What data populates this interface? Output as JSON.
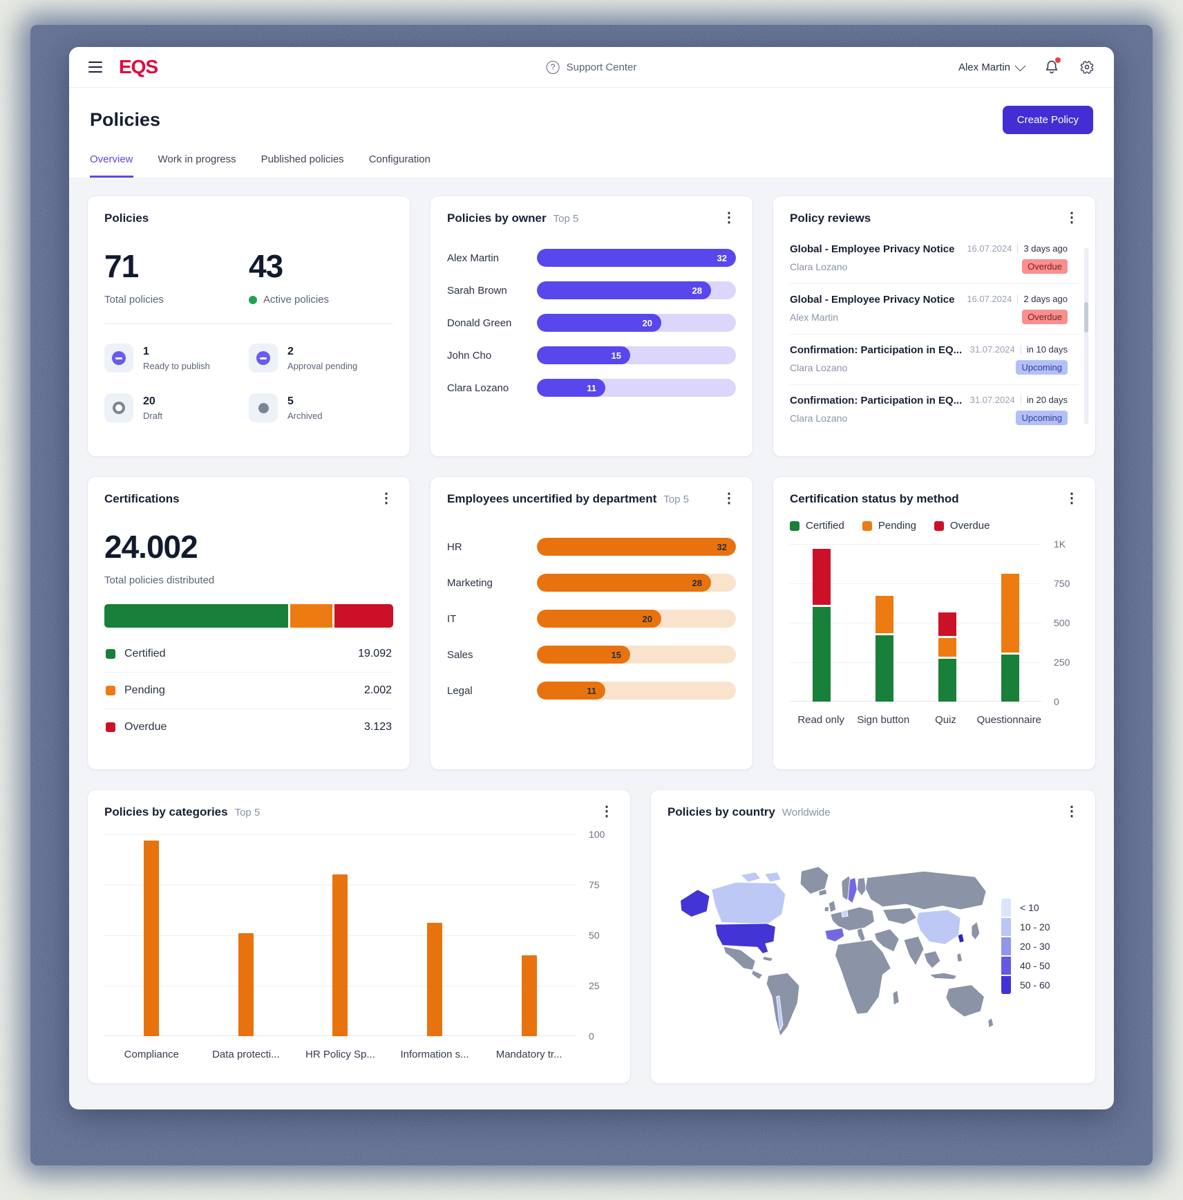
{
  "header": {
    "support_label": "Support Center",
    "user_name": "Alex Martin",
    "has_notification": true
  },
  "page": {
    "title": "Policies",
    "create_button": "Create Policy",
    "tabs": [
      {
        "label": "Overview",
        "active": true
      },
      {
        "label": "Work in progress",
        "active": false
      },
      {
        "label": "Published policies",
        "active": false
      },
      {
        "label": "Configuration",
        "active": false
      }
    ]
  },
  "colors": {
    "brand": "#e4003c",
    "accent_purple": "#5b48ee",
    "button_purple": "#432ed4",
    "bar_purple": "#5847ec",
    "bar_purple_track": "#dcd6fa",
    "bar_orange": "#e8730e",
    "bar_orange_track": "#fae3cc",
    "green": "#188038",
    "orange": "#ee7b11",
    "red": "#cc1028",
    "active_green": "#21a24d",
    "badge_overdue_bg": "#f98f8f",
    "badge_overdue_text": "#7c1d1d",
    "badge_upcoming_bg": "#b3c0f7",
    "badge_upcoming_text": "#2f3c9a"
  },
  "policies_card": {
    "title": "Policies",
    "total_value": "71",
    "total_label": "Total policies",
    "active_value": "43",
    "active_label": "Active policies",
    "stats": [
      {
        "value": "1",
        "label": "Ready to publish",
        "icon": "minus-circle-purple"
      },
      {
        "value": "2",
        "label": "Approval pending",
        "icon": "minus-circle-purple"
      },
      {
        "value": "20",
        "label": "Draft",
        "icon": "ring-gray"
      },
      {
        "value": "5",
        "label": "Archived",
        "icon": "solid-circle-gray"
      }
    ]
  },
  "reviews_card": {
    "title": "Policy reviews",
    "items": [
      {
        "title": "Global - Employee Privacy Notice",
        "owner": "Clara Lozano",
        "date": "16.07.2024",
        "relative": "3 days ago",
        "status_label": "Overdue",
        "status": "overdue"
      },
      {
        "title": "Global - Employee Privacy Notice",
        "owner": "Alex Martin",
        "date": "16.07.2024",
        "relative": "2 days ago",
        "status_label": "Overdue",
        "status": "overdue"
      },
      {
        "title": "Confirmation: Participation in EQ...",
        "owner": "Clara Lozano",
        "date": "31.07.2024",
        "relative": "in 10 days",
        "status_label": "Upcoming",
        "status": "upcoming"
      },
      {
        "title": "Confirmation: Participation in EQ...",
        "owner": "Clara Lozano",
        "date": "31.07.2024",
        "relative": "in 20 days",
        "status_label": "Upcoming",
        "status": "upcoming"
      }
    ]
  },
  "chart_data": [
    {
      "type": "bar",
      "orientation": "horizontal",
      "title": "Policies by owner",
      "subtitle": "Top 5",
      "categories": [
        "Alex Martin",
        "Sarah Brown",
        "Donald Green",
        "John Cho",
        "Clara Lozano"
      ],
      "values": [
        32,
        28,
        20,
        15,
        11
      ],
      "max": 32
    },
    {
      "type": "bar",
      "orientation": "horizontal",
      "title": "Employees uncertified by department",
      "subtitle": "Top 5",
      "categories": [
        "HR",
        "Marketing",
        "IT",
        "Sales",
        "Legal"
      ],
      "values": [
        32,
        28,
        20,
        15,
        11
      ],
      "max": 32
    },
    {
      "type": "bar",
      "stacked": true,
      "title": "Certification status by method",
      "categories": [
        "Read only",
        "Sign button",
        "Quiz",
        "Questionnaire"
      ],
      "series": [
        {
          "name": "Certified",
          "color": "#188038",
          "values": [
            600,
            420,
            270,
            300
          ]
        },
        {
          "name": "Pending",
          "color": "#ee7b11",
          "values": [
            0,
            240,
            120,
            500
          ]
        },
        {
          "name": "Overdue",
          "color": "#cc1028",
          "values": [
            355,
            0,
            150,
            0
          ]
        }
      ],
      "ylim": [
        0,
        1000
      ],
      "yticks": [
        "1K",
        "750",
        "500",
        "250",
        "0"
      ],
      "legend_position": "top",
      "grid": true
    },
    {
      "type": "bar",
      "title": "Policies by categories",
      "subtitle": "Top 5",
      "categories": [
        "Compliance",
        "Data protecti...",
        "HR Policy Sp...",
        "Information s...",
        "Mandatory tr..."
      ],
      "values": [
        97,
        51,
        80,
        56,
        40
      ],
      "ylim": [
        0,
        100
      ],
      "yticks": [
        "100",
        "75",
        "50",
        "25",
        "0"
      ],
      "grid": true
    },
    {
      "type": "stacked-bar",
      "title": "Certifications",
      "total": "24.002",
      "total_label": "Total policies distributed",
      "segments": [
        {
          "label": "Certified",
          "value": "19.092",
          "color": "#188038",
          "width_pct": 64.5
        },
        {
          "label": "Pending",
          "value": "2.002",
          "color": "#ee7b11",
          "width_pct": 14.8
        },
        {
          "label": "Overdue",
          "value": "3.123",
          "color": "#cc1028",
          "width_pct": 20.7
        }
      ]
    },
    {
      "type": "heatmap",
      "title": "Policies by country",
      "subtitle": "Worldwide",
      "legend": [
        "< 10",
        "10 - 20",
        "20 - 30",
        "40 - 50",
        "50 - 60"
      ],
      "legend_colors": [
        "#dbe4fb",
        "#b9c6f6",
        "#8f97ec",
        "#6459e2",
        "#4331d8"
      ],
      "highlighted_countries": {
        "United States": "50 - 60",
        "Canada": "10 - 20",
        "Sweden": "20 - 30",
        "Spain": "20 - 30",
        "China": "10 - 20",
        "South Korea": "50 - 60"
      }
    }
  ]
}
